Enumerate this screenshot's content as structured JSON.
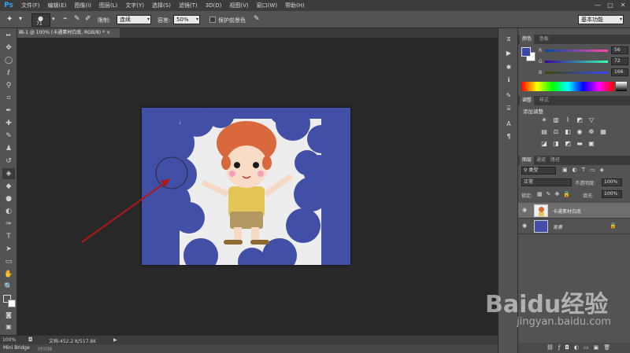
{
  "app": {
    "logo": "Ps"
  },
  "menu": [
    "文件(F)",
    "编辑(E)",
    "图像(I)",
    "图层(L)",
    "文字(Y)",
    "选择(S)",
    "滤镜(T)",
    "3D(D)",
    "视图(V)",
    "窗口(W)",
    "帮助(H)"
  ],
  "window_controls": [
    "—",
    "□",
    "✕"
  ],
  "options_bar": {
    "brush_size": "71",
    "limit_label": "限制:",
    "limit_value": "连续",
    "tolerance_label": "容差:",
    "tolerance_value": "50%",
    "protect_fg_label": "保护前景色",
    "workspace": "基本功能"
  },
  "document": {
    "tab_title": "卡通素材白底.jpg @ 100% (卡通素材白底, RGB/8) *",
    "tab_visible": "画-1 @ 100% (卡通素材白底, RGB/8) *"
  },
  "status": {
    "zoom": "100%",
    "doc_info": "文档:452.2 K/517.8K"
  },
  "bottom_tabs": {
    "mini_bridge": "Mini Bridge",
    "timeline": "时间轴"
  },
  "color_panel": {
    "tabs": [
      "颜色",
      "色板"
    ],
    "r_label": "R",
    "r": "56",
    "g_label": "G",
    "g": "72",
    "b_label": "B",
    "b": "166",
    "fg_color": "#3848a6"
  },
  "adjust_panel": {
    "tabs": [
      "调整",
      "样式"
    ],
    "title": "添加调整"
  },
  "layers_panel": {
    "tabs": [
      "图层",
      "通道",
      "路径"
    ],
    "filter": "类型",
    "blend_mode": "正常",
    "opacity_label": "不透明度:",
    "opacity": "100%",
    "lock_label": "锁定:",
    "fill_label": "填充:",
    "fill": "100%",
    "layers": [
      {
        "name": "卡通素材白底",
        "selected": true
      },
      {
        "name": "背景",
        "selected": false
      }
    ]
  },
  "watermark": {
    "brand": "Baidu经验",
    "url": "jingyan.baidu.com"
  }
}
